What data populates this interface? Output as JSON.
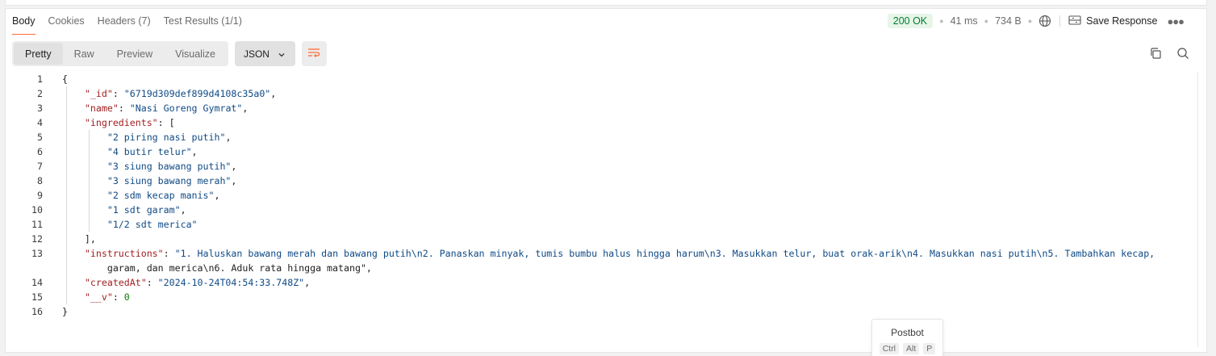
{
  "tabs": [
    {
      "label": "Body",
      "active": true
    },
    {
      "label": "Cookies",
      "active": false
    },
    {
      "label": "Headers (7)",
      "active": false
    },
    {
      "label": "Test Results (1/1)",
      "active": false
    }
  ],
  "status": {
    "code": "200 OK",
    "time": "41 ms",
    "size": "734 B",
    "save_label": "Save Response",
    "status_color": "#007f31"
  },
  "view_modes": [
    "Pretty",
    "Raw",
    "Preview",
    "Visualize"
  ],
  "active_view": "Pretty",
  "format": "JSON",
  "accent_color": "#ff6c37",
  "icons": [
    "globe-icon",
    "save-response-icon",
    "more-icon",
    "chevron-down-icon",
    "wrap-lines-icon",
    "copy-icon",
    "search-icon"
  ],
  "code_lines": [
    "{",
    "    \"_id\": \"6719d309def899d4108c35a0\",",
    "    \"name\": \"Nasi Goreng Gymrat\",",
    "    \"ingredients\": [",
    "        \"2 piring nasi putih\",",
    "        \"4 butir telur\",",
    "        \"3 siung bawang putih\",",
    "        \"3 siung bawang merah\",",
    "        \"2 sdm kecap manis\",",
    "        \"1 sdt garam\",",
    "        \"1/2 sdt merica\"",
    "    ],",
    "    \"instructions\": \"1. Haluskan bawang merah dan bawang putih\\n2. Panaskan minyak, tumis bumbu halus hingga harum\\n3. Masukkan telur, buat orak-arik\\n4. Masukkan nasi putih\\n5. Tambahkan kecap,\n        garam, dan merica\\n6. Aduk rata hingga matang\",",
    "    \"createdAt\": \"2024-10-24T04:54:33.748Z\",",
    "    \"__v\": 0",
    "}"
  ],
  "postbot": {
    "title": "Postbot",
    "keys": [
      "Ctrl",
      "Alt",
      "P"
    ]
  }
}
